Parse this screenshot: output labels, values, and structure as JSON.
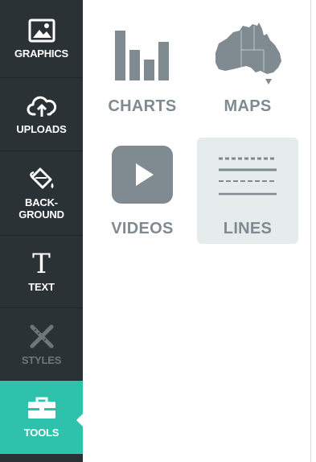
{
  "sidebar": {
    "items": [
      {
        "label": "GRAPHICS",
        "icon": "image-icon"
      },
      {
        "label": "UPLOADS",
        "icon": "cloud-upload-icon"
      },
      {
        "label": "BACK-\nGROUND",
        "icon": "paint-bucket-icon"
      },
      {
        "label": "TEXT",
        "icon": "text-t-icon"
      },
      {
        "label": "STYLES",
        "icon": "brush-ruler-icon",
        "disabled": true
      },
      {
        "label": "TOOLS",
        "icon": "toolbox-icon",
        "active": true
      }
    ],
    "active_color": "#2ec1ac",
    "background_color": "#2a3235"
  },
  "tools": {
    "items": [
      {
        "label": "CHARTS",
        "icon": "bar-chart-icon"
      },
      {
        "label": "MAPS",
        "icon": "australia-map-icon"
      },
      {
        "label": "VIDEOS",
        "icon": "play-video-icon"
      },
      {
        "label": "LINES",
        "icon": "lines-icon",
        "selected": true
      }
    ],
    "icon_color": "#7f8b90"
  }
}
